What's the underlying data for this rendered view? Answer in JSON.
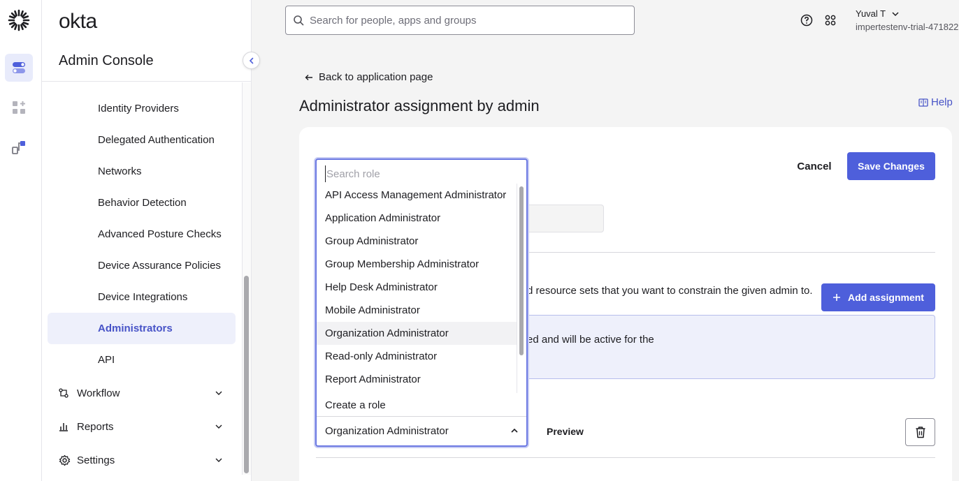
{
  "app": {
    "brand": "okta",
    "console_title": "Admin Console",
    "accent": "#4e5fdb"
  },
  "rail": {
    "icons": [
      "okta-sunburst-logo",
      "toggle-icon",
      "apps-plus-icon",
      "workflow-icon"
    ]
  },
  "sidenav": {
    "items": [
      {
        "label": "Identity Providers",
        "active": false
      },
      {
        "label": "Delegated Authentication",
        "active": false
      },
      {
        "label": "Networks",
        "active": false
      },
      {
        "label": "Behavior Detection",
        "active": false
      },
      {
        "label": "Advanced Posture Checks",
        "active": false
      },
      {
        "label": "Device Assurance Policies",
        "active": false
      },
      {
        "label": "Device Integrations",
        "active": false
      },
      {
        "label": "Administrators",
        "active": true
      },
      {
        "label": "API",
        "active": false
      }
    ],
    "groups": [
      {
        "label": "Workflow",
        "icon": "workflow-icon"
      },
      {
        "label": "Reports",
        "icon": "bar-chart-icon"
      },
      {
        "label": "Settings",
        "icon": "gear-icon"
      }
    ]
  },
  "topbar": {
    "search_placeholder": "Search for people, apps and groups",
    "user_name": "Yuval T",
    "user_org": "impertestenv-trial-471822"
  },
  "main": {
    "back_label": "Back to application page",
    "title": "Administrator assignment by admin",
    "help_label": "Help",
    "cancel_label": "Cancel",
    "save_label": "Save Changes",
    "description": "d resource sets that you want to constrain the given admin to.",
    "add_assignment_label": "Add assignment",
    "info_text": "ed and will be active for the",
    "preview_label": "Preview"
  },
  "role_dropdown": {
    "search_placeholder": "Search role",
    "options": [
      "API Access Management Administrator",
      "Application Administrator",
      "Group Administrator",
      "Group Membership Administrator",
      "Help Desk Administrator",
      "Mobile Administrator",
      "Organization Administrator",
      "Read-only Administrator",
      "Report Administrator"
    ],
    "highlighted": "Organization Administrator",
    "create_label": "Create a role",
    "selected_value": "Organization Administrator"
  }
}
